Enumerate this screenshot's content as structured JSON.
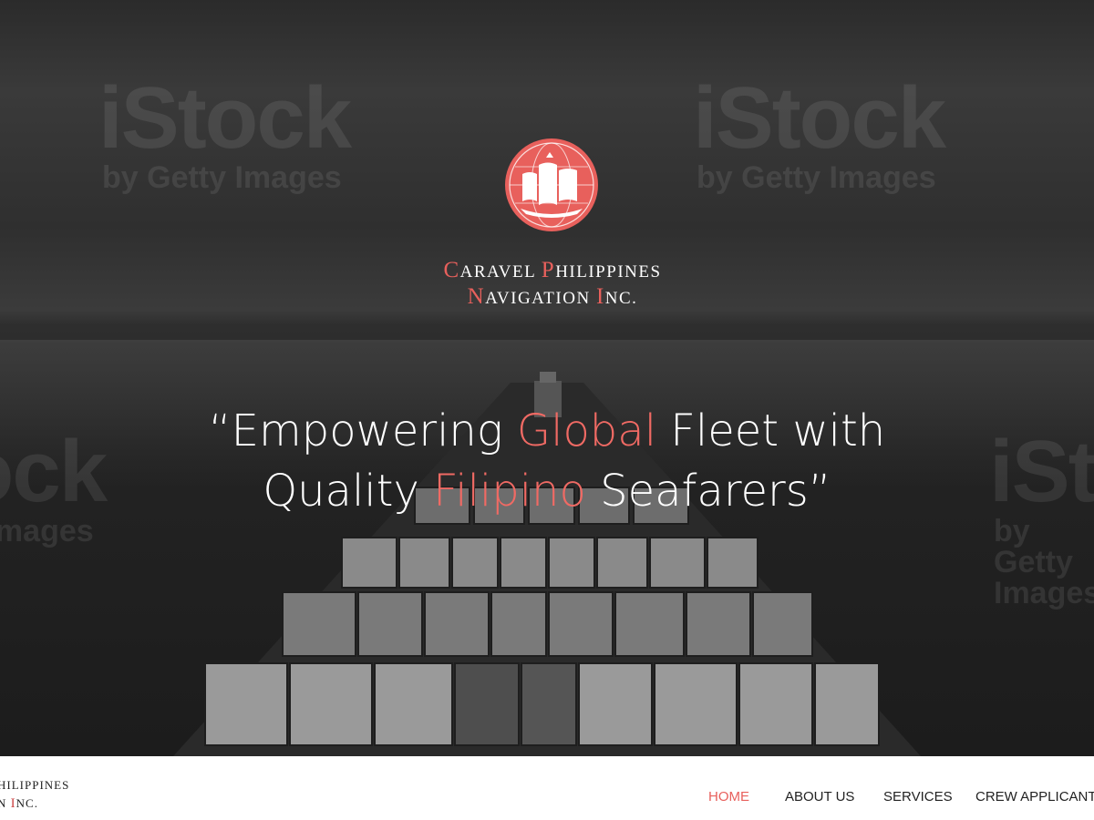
{
  "hero": {
    "watermark": {
      "main": "iStock",
      "sub": "by Getty Images"
    },
    "company": {
      "line1_cap1": "C",
      "line1_rest1": "ARAVEL ",
      "line1_cap2": "P",
      "line1_rest2": "HILIPPINES",
      "line2_cap1": "N",
      "line2_rest1": "AVIGATION ",
      "line2_cap2": "I",
      "line2_rest2": "NC."
    },
    "tagline": {
      "part1": "“Empowering ",
      "accent1": "Global",
      "part2": " Fleet with",
      "part3": "Quality ",
      "accent2": "Filipino",
      "part4": " Seafarers”"
    }
  },
  "navbar": {
    "logo_line1": "HILIPPINES",
    "logo_line2_pre": "N ",
    "logo_line2_cap": "I",
    "logo_line2_rest": "NC.",
    "items": [
      {
        "label": "HOME",
        "active": true
      },
      {
        "label": "ABOUT US",
        "active": false
      },
      {
        "label": "SERVICES",
        "active": false
      },
      {
        "label": "CREW APPLICANTS",
        "active": false
      }
    ]
  },
  "colors": {
    "accent": "#e8605c",
    "nav_text": "#222222",
    "hero_text": "#ffffff"
  }
}
